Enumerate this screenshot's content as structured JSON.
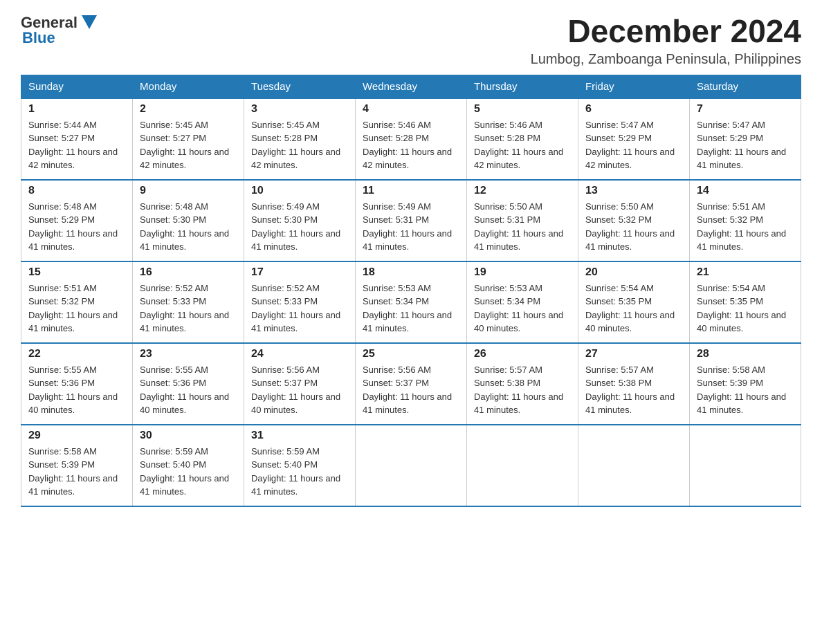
{
  "header": {
    "logo_general": "General",
    "logo_blue": "Blue",
    "title": "December 2024",
    "subtitle": "Lumbog, Zamboanga Peninsula, Philippines"
  },
  "days_of_week": [
    "Sunday",
    "Monday",
    "Tuesday",
    "Wednesday",
    "Thursday",
    "Friday",
    "Saturday"
  ],
  "weeks": [
    [
      {
        "day": "1",
        "sunrise": "5:44 AM",
        "sunset": "5:27 PM",
        "daylight": "11 hours and 42 minutes."
      },
      {
        "day": "2",
        "sunrise": "5:45 AM",
        "sunset": "5:27 PM",
        "daylight": "11 hours and 42 minutes."
      },
      {
        "day": "3",
        "sunrise": "5:45 AM",
        "sunset": "5:28 PM",
        "daylight": "11 hours and 42 minutes."
      },
      {
        "day": "4",
        "sunrise": "5:46 AM",
        "sunset": "5:28 PM",
        "daylight": "11 hours and 42 minutes."
      },
      {
        "day": "5",
        "sunrise": "5:46 AM",
        "sunset": "5:28 PM",
        "daylight": "11 hours and 42 minutes."
      },
      {
        "day": "6",
        "sunrise": "5:47 AM",
        "sunset": "5:29 PM",
        "daylight": "11 hours and 42 minutes."
      },
      {
        "day": "7",
        "sunrise": "5:47 AM",
        "sunset": "5:29 PM",
        "daylight": "11 hours and 41 minutes."
      }
    ],
    [
      {
        "day": "8",
        "sunrise": "5:48 AM",
        "sunset": "5:29 PM",
        "daylight": "11 hours and 41 minutes."
      },
      {
        "day": "9",
        "sunrise": "5:48 AM",
        "sunset": "5:30 PM",
        "daylight": "11 hours and 41 minutes."
      },
      {
        "day": "10",
        "sunrise": "5:49 AM",
        "sunset": "5:30 PM",
        "daylight": "11 hours and 41 minutes."
      },
      {
        "day": "11",
        "sunrise": "5:49 AM",
        "sunset": "5:31 PM",
        "daylight": "11 hours and 41 minutes."
      },
      {
        "day": "12",
        "sunrise": "5:50 AM",
        "sunset": "5:31 PM",
        "daylight": "11 hours and 41 minutes."
      },
      {
        "day": "13",
        "sunrise": "5:50 AM",
        "sunset": "5:32 PM",
        "daylight": "11 hours and 41 minutes."
      },
      {
        "day": "14",
        "sunrise": "5:51 AM",
        "sunset": "5:32 PM",
        "daylight": "11 hours and 41 minutes."
      }
    ],
    [
      {
        "day": "15",
        "sunrise": "5:51 AM",
        "sunset": "5:32 PM",
        "daylight": "11 hours and 41 minutes."
      },
      {
        "day": "16",
        "sunrise": "5:52 AM",
        "sunset": "5:33 PM",
        "daylight": "11 hours and 41 minutes."
      },
      {
        "day": "17",
        "sunrise": "5:52 AM",
        "sunset": "5:33 PM",
        "daylight": "11 hours and 41 minutes."
      },
      {
        "day": "18",
        "sunrise": "5:53 AM",
        "sunset": "5:34 PM",
        "daylight": "11 hours and 41 minutes."
      },
      {
        "day": "19",
        "sunrise": "5:53 AM",
        "sunset": "5:34 PM",
        "daylight": "11 hours and 40 minutes."
      },
      {
        "day": "20",
        "sunrise": "5:54 AM",
        "sunset": "5:35 PM",
        "daylight": "11 hours and 40 minutes."
      },
      {
        "day": "21",
        "sunrise": "5:54 AM",
        "sunset": "5:35 PM",
        "daylight": "11 hours and 40 minutes."
      }
    ],
    [
      {
        "day": "22",
        "sunrise": "5:55 AM",
        "sunset": "5:36 PM",
        "daylight": "11 hours and 40 minutes."
      },
      {
        "day": "23",
        "sunrise": "5:55 AM",
        "sunset": "5:36 PM",
        "daylight": "11 hours and 40 minutes."
      },
      {
        "day": "24",
        "sunrise": "5:56 AM",
        "sunset": "5:37 PM",
        "daylight": "11 hours and 40 minutes."
      },
      {
        "day": "25",
        "sunrise": "5:56 AM",
        "sunset": "5:37 PM",
        "daylight": "11 hours and 41 minutes."
      },
      {
        "day": "26",
        "sunrise": "5:57 AM",
        "sunset": "5:38 PM",
        "daylight": "11 hours and 41 minutes."
      },
      {
        "day": "27",
        "sunrise": "5:57 AM",
        "sunset": "5:38 PM",
        "daylight": "11 hours and 41 minutes."
      },
      {
        "day": "28",
        "sunrise": "5:58 AM",
        "sunset": "5:39 PM",
        "daylight": "11 hours and 41 minutes."
      }
    ],
    [
      {
        "day": "29",
        "sunrise": "5:58 AM",
        "sunset": "5:39 PM",
        "daylight": "11 hours and 41 minutes."
      },
      {
        "day": "30",
        "sunrise": "5:59 AM",
        "sunset": "5:40 PM",
        "daylight": "11 hours and 41 minutes."
      },
      {
        "day": "31",
        "sunrise": "5:59 AM",
        "sunset": "5:40 PM",
        "daylight": "11 hours and 41 minutes."
      },
      null,
      null,
      null,
      null
    ]
  ],
  "labels": {
    "sunrise": "Sunrise:",
    "sunset": "Sunset:",
    "daylight": "Daylight:"
  }
}
